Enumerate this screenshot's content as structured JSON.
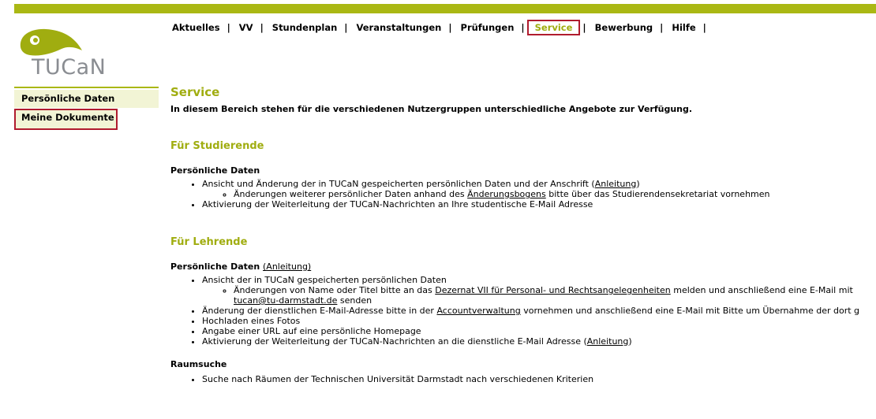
{
  "logo": {
    "text": "TUCaN"
  },
  "nav": {
    "items": [
      {
        "label": "Aktuelles"
      },
      {
        "label": "VV"
      },
      {
        "label": "Stundenplan"
      },
      {
        "label": "Veranstaltungen"
      },
      {
        "label": "Prüfungen"
      },
      {
        "label": "Service"
      },
      {
        "label": "Bewerbung"
      },
      {
        "label": "Hilfe"
      }
    ],
    "separator": "|"
  },
  "sidebar": {
    "items": [
      {
        "label": "Persönliche Daten"
      },
      {
        "label": "Meine Dokumente"
      }
    ]
  },
  "main": {
    "title": "Service",
    "intro": "In diesem Bereich stehen für die verschiedenen Nutzergruppen unterschiedliche Angebote zur Verfügung.",
    "students": {
      "heading": "Für Studierende",
      "pd_title": "Persönliche Daten",
      "b1_text": "Ansicht und Änderung der in TUCaN gespeicherten persönlichen Daten und der Anschrift (",
      "b1_link": "Anleitung",
      "b1_end": ")",
      "b1_sub_pre": "Änderungen weiterer persönlicher Daten anhand des ",
      "b1_sub_link": "Änderungsbogens",
      "b1_sub_post": " bitte über das Studierendensekretariat vornehmen",
      "b2_text": "Aktivierung der Weiterleitung der TUCaN-Nachrichten an Ihre studentische E-Mail Adresse"
    },
    "teachers": {
      "heading": "Für Lehrende",
      "pd_title": "Persönliche Daten",
      "pd_link": "(Anleitung)",
      "b1_text": "Ansicht der in TUCaN gespeicherten persönlichen Daten",
      "b1_sub_pre": "Änderungen von Name oder Titel bitte an das ",
      "b1_sub_link": "Dezernat VII für Personal- und Rechtsangelegenheiten",
      "b1_sub_post": " melden und anschließend eine E-Mail mit",
      "b1_sub_email": "tucan@tu-darmstadt.de",
      "b1_sub_end": " senden",
      "b2_pre": "Änderung der dienstlichen E-Mail-Adresse bitte in der ",
      "b2_link": "Accountverwaltung",
      "b2_post": " vornehmen und anschließend eine E-Mail mit Bitte um Übernahme der dort g",
      "b3_text": "Hochladen eines Fotos",
      "b4_text": "Angabe einer URL auf eine persönliche Homepage",
      "b5_pre": "Aktivierung der Weiterleitung der TUCaN-Nachrichten an die dienstliche E-Mail Adresse (",
      "b5_link": "Anleitung",
      "b5_end": ")"
    },
    "room": {
      "title": "Raumsuche",
      "b1_text": "Suche nach Räumen der Technischen Universität Darmstadt nach verschiedenen Kriterien"
    }
  }
}
